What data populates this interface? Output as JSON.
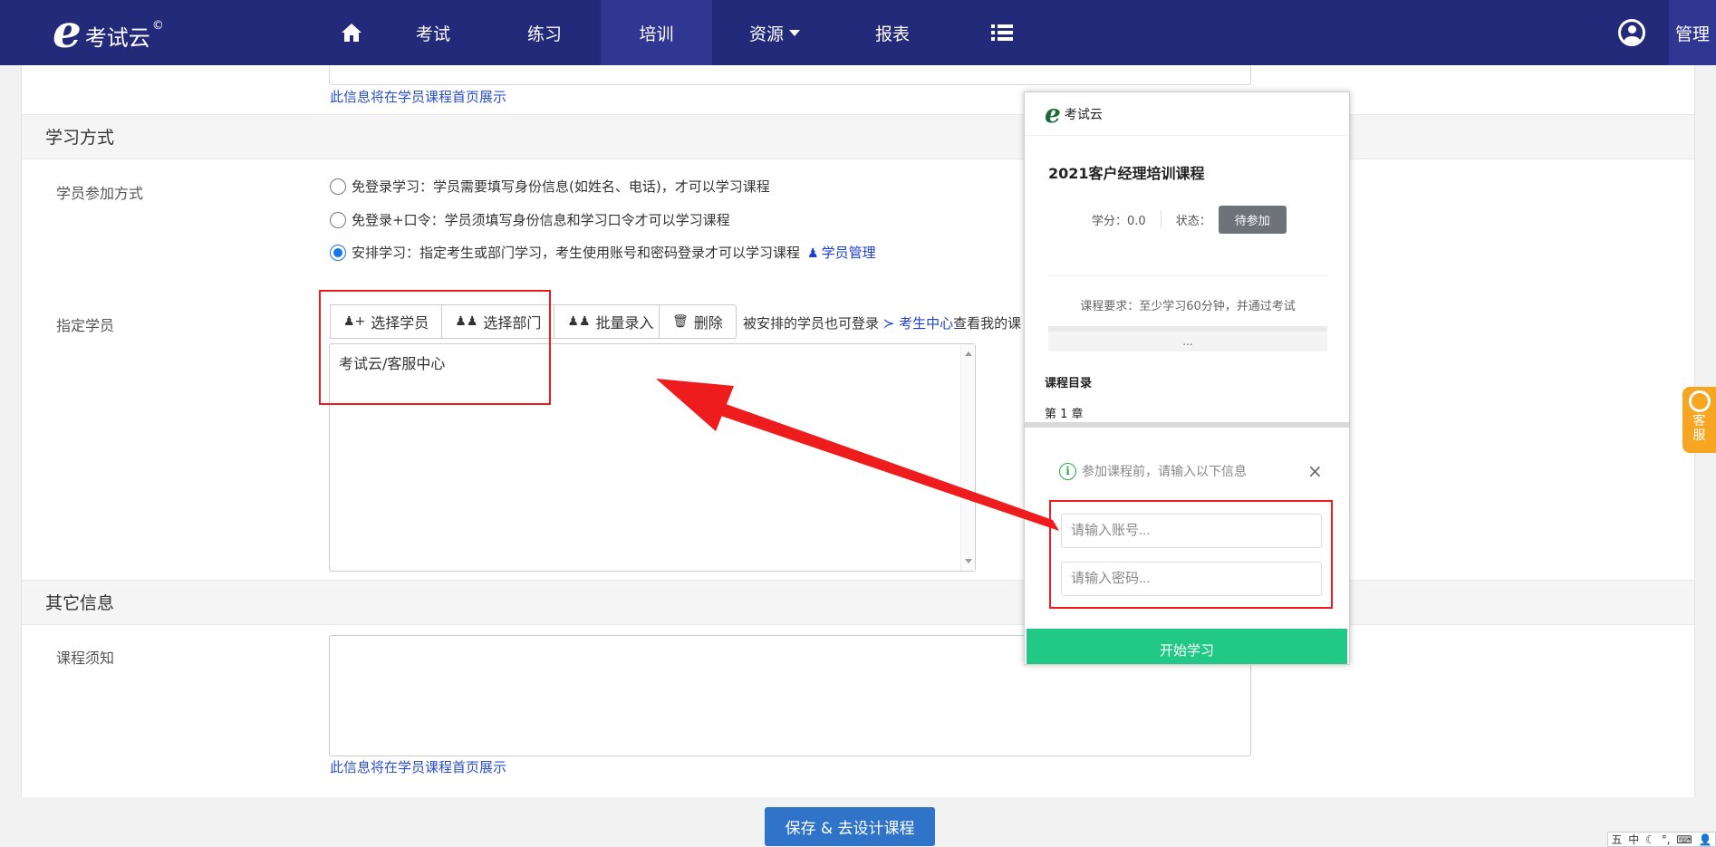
{
  "navbar": {
    "logo_text": "考试云",
    "logo_mark": "©",
    "items": [
      {
        "label": "",
        "icon": "home-icon"
      },
      {
        "label": "考试"
      },
      {
        "label": "练习"
      },
      {
        "label": "培训"
      },
      {
        "label": "资源"
      },
      {
        "label": "报表"
      },
      {
        "label": "",
        "icon": "list-icon"
      }
    ],
    "manage_label": "管理"
  },
  "top_hint": "此信息将在学员课程首页展示",
  "study_mode": {
    "title": "学习方式",
    "join_label": "学员参加方式",
    "options": [
      {
        "text": "免登录学习：学员需要填写身份信息(如姓名、电话)，才可以学习课程"
      },
      {
        "text": "免登录+口令：学员须填写身份信息和学习口令才可以学习课程"
      },
      {
        "text": "安排学习：指定考生或部门学习，考生使用账号和密码登录才可以学习课程"
      }
    ],
    "student_manage_link": "学员管理"
  },
  "assign": {
    "label": "指定学员",
    "buttons": {
      "select_student": "选择学员",
      "select_dept": "选择部门",
      "batch_input": "批量录入",
      "delete": "删除"
    },
    "tip_prefix": "被安排的学员也可登录",
    "tip_link": "考生中心",
    "tip_suffix": "查看我的课",
    "selected_value": "考试云/客服中心"
  },
  "other": {
    "title": "其它信息",
    "notice_label": "课程须知",
    "hint": "此信息将在学员课程首页展示"
  },
  "save_button": "保存 & 去设计课程",
  "preview": {
    "logo_text": "考试云",
    "course_title": "2021客户经理培训课程",
    "credit": "学分：0.0",
    "status_label": "状态：",
    "status_value": "待参加",
    "requirement": "课程要求：至少学习60分钟，并通过考试",
    "dots": "...",
    "catalog": "课程目录",
    "chapter": "第 1 章",
    "dialog_msg": "参加课程前，请输入以下信息",
    "close": "×",
    "account_placeholder": "请输入账号...",
    "password_placeholder": "请输入密码...",
    "start_button": "开始学习"
  },
  "kefu": {
    "line1": "客",
    "line2": "服"
  },
  "ime": {
    "items": [
      "五",
      "中",
      "☾",
      "°,",
      "⌨",
      "👤"
    ]
  },
  "colors": {
    "navbar": "#232a7a",
    "accent": "#2f74c9",
    "start": "#22c986",
    "annotation": "#ee1c1c"
  }
}
